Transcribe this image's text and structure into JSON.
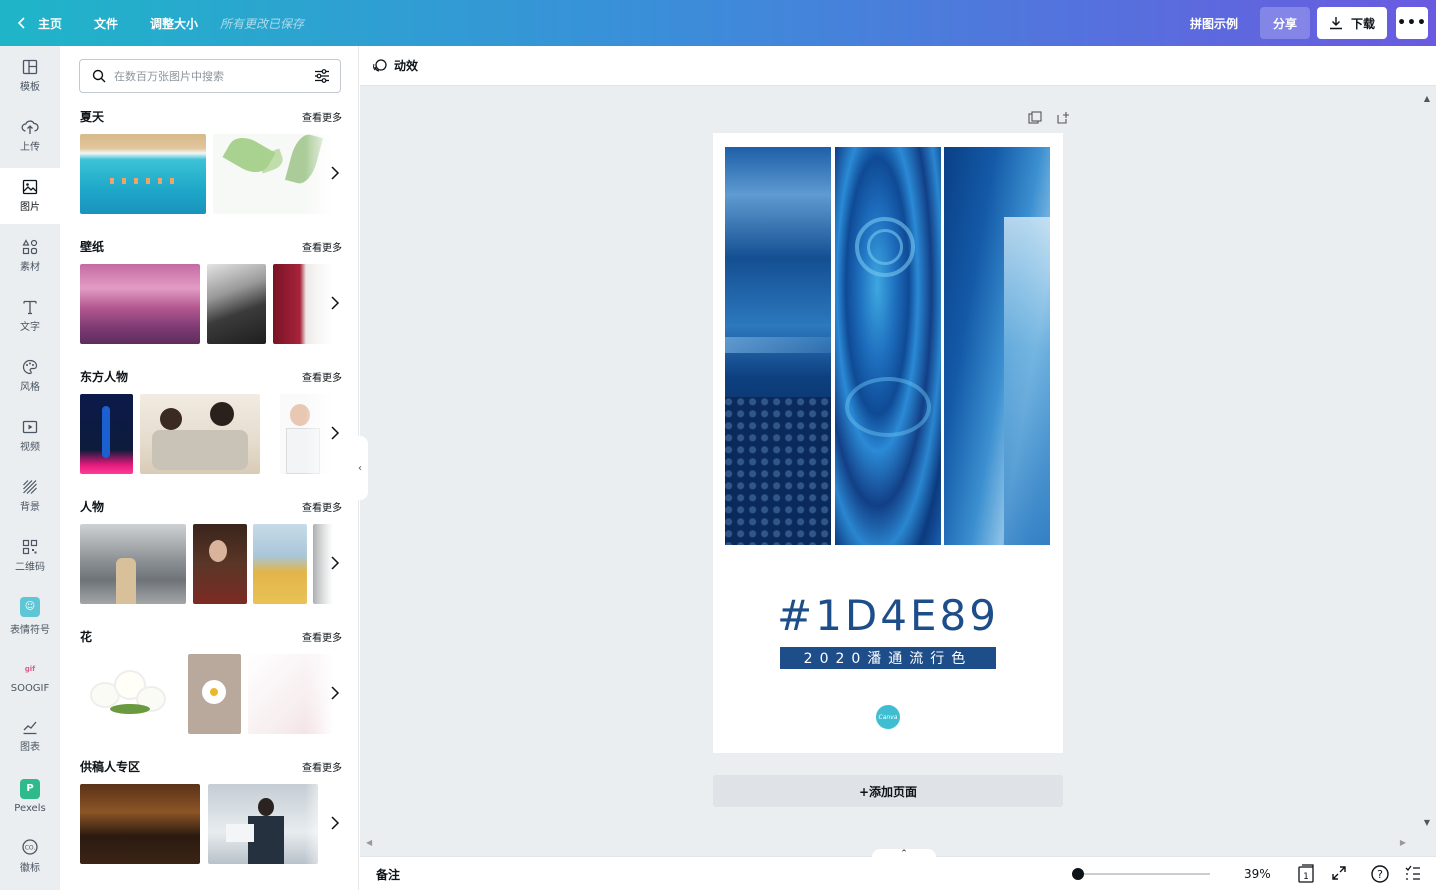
{
  "topbar": {
    "home_label": "主页",
    "file_label": "文件",
    "resize_label": "调整大小",
    "saved_status": "所有更改已保存",
    "demo_label": "拼图示例",
    "share_label": "分享",
    "download_label": "下载",
    "more_label": "•••"
  },
  "rail": {
    "items": [
      {
        "label": "模板",
        "icon": "template-icon"
      },
      {
        "label": "上传",
        "icon": "upload-icon"
      },
      {
        "label": "图片",
        "icon": "image-icon"
      },
      {
        "label": "素材",
        "icon": "elements-icon"
      },
      {
        "label": "文字",
        "icon": "text-icon"
      },
      {
        "label": "风格",
        "icon": "palette-icon"
      },
      {
        "label": "视频",
        "icon": "video-icon"
      },
      {
        "label": "背景",
        "icon": "background-icon"
      },
      {
        "label": "二维码",
        "icon": "qrcode-icon"
      },
      {
        "label": "表情符号",
        "icon": "emoji-icon"
      },
      {
        "label": "SOOGIF",
        "icon": "soogif-icon"
      },
      {
        "label": "图表",
        "icon": "chart-icon"
      },
      {
        "label": "Pexels",
        "icon": "pexels-icon"
      },
      {
        "label": "徽标",
        "icon": "logo-icon"
      }
    ],
    "active_index": 2
  },
  "panel": {
    "search_placeholder": "在数百万张图片中搜索",
    "see_more": "查看更多",
    "sections": [
      {
        "title": "夏天"
      },
      {
        "title": "壁纸"
      },
      {
        "title": "东方人物"
      },
      {
        "title": "人物"
      },
      {
        "title": "花"
      },
      {
        "title": "供稿人专区"
      }
    ]
  },
  "canvas": {
    "animate_label": "动效",
    "hex_text": "#1D4E89",
    "subtitle": "2020潘通流行色",
    "logo_text": "Canva",
    "add_page_label": "+添加页面",
    "accent_color": "#1d4e89"
  },
  "bottombar": {
    "notes_label": "备注",
    "zoom_value": "39%",
    "page_count": "1"
  }
}
